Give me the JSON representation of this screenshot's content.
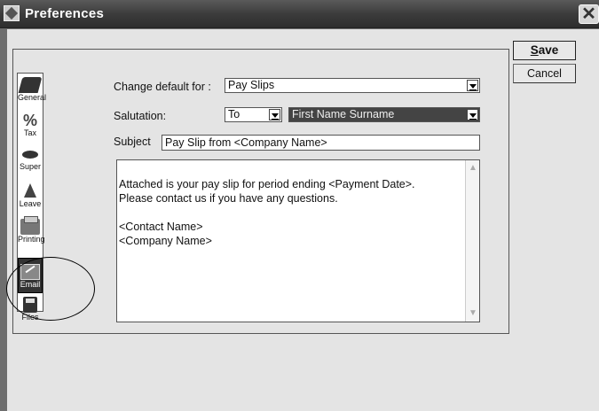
{
  "window": {
    "title": "Preferences",
    "close_label": "✕"
  },
  "sidebar": {
    "items": [
      {
        "label": "General",
        "icon": "general-icon"
      },
      {
        "label": "Tax",
        "icon": "percent-icon"
      },
      {
        "label": "Super",
        "icon": "super-icon"
      },
      {
        "label": "Leave",
        "icon": "leave-icon"
      },
      {
        "label": "Printing",
        "icon": "printer-icon"
      },
      {
        "label": "Email",
        "icon": "email-icon",
        "selected": true
      },
      {
        "label": "Files",
        "icon": "files-icon"
      }
    ]
  },
  "form": {
    "change_default_label": "Change default for :",
    "change_default_value": "Pay Slips",
    "salutation_label": "Salutation:",
    "salutation_value": "To",
    "name_format_value": "First Name Surname",
    "subject_label": "Subject",
    "subject_value": "Pay Slip from <Company Name>",
    "body_text": "Attached is your pay slip for period ending <Payment Date>.\nPlease contact us if you have any questions.\n\n<Contact Name>\n<Company Name>"
  },
  "buttons": {
    "save_prefix": "",
    "save_mnemonic": "S",
    "save_rest": "ave",
    "cancel_label": "Cancel"
  }
}
